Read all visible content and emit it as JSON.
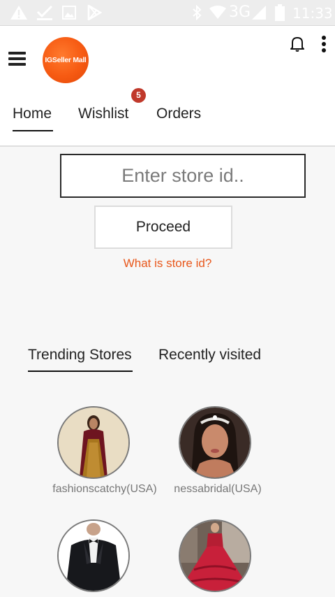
{
  "status_bar": {
    "network": "3G",
    "time": "11:33"
  },
  "header": {
    "logo_text": "IGSeller Mall",
    "tabs": [
      {
        "label": "Home"
      },
      {
        "label": "Wishlist"
      },
      {
        "label": "Orders"
      }
    ],
    "wishlist_badge": "5"
  },
  "store_form": {
    "placeholder": "Enter store id..",
    "proceed_label": "Proceed",
    "help_link": "What is store id?"
  },
  "store_tabs": [
    {
      "label": "Trending Stores"
    },
    {
      "label": "Recently visited"
    }
  ],
  "stores": [
    {
      "name": "fashionscatchy(USA)"
    },
    {
      "name": "nessabridal(USA)"
    },
    {
      "name": ""
    },
    {
      "name": ""
    }
  ],
  "colors": {
    "accent": "#e8571b",
    "badge": "#c0392b",
    "logo": "#f65a12"
  }
}
